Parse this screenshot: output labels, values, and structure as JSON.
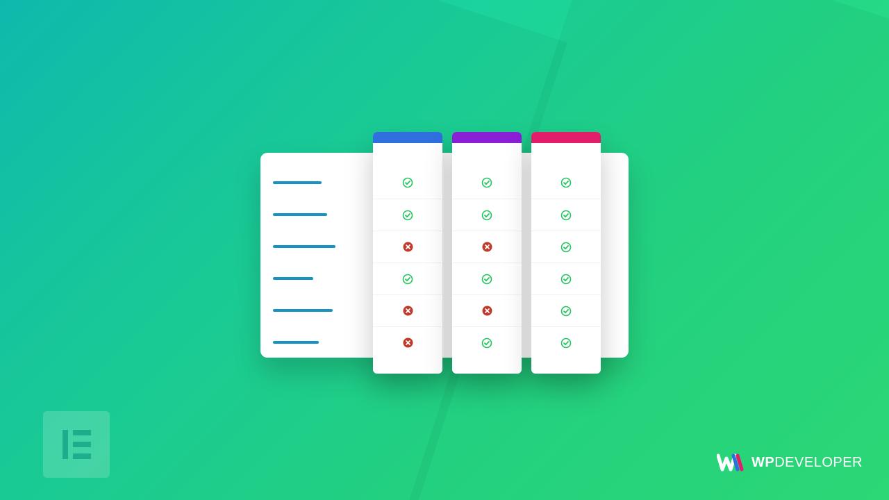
{
  "brand": {
    "name_bold": "WP",
    "name_light": "DEVELOPER"
  },
  "badge": {
    "name": "elementor"
  },
  "colors": {
    "plan_a": "#2f6fe0",
    "plan_b": "#8a20d6",
    "plan_c": "#e21e6b",
    "check": "#22c55e",
    "cross": "#c0392b",
    "label_line": "#1693c4"
  },
  "comparison": {
    "features": [
      {
        "line_width": 70
      },
      {
        "line_width": 78
      },
      {
        "line_width": 90
      },
      {
        "line_width": 58
      },
      {
        "line_width": 86
      },
      {
        "line_width": 66
      }
    ],
    "plans": [
      {
        "cap_class": "cap-blue",
        "cells": [
          "check",
          "check",
          "cross",
          "check",
          "cross",
          "cross"
        ]
      },
      {
        "cap_class": "cap-purple",
        "cells": [
          "check",
          "check",
          "cross",
          "check",
          "cross",
          "check"
        ]
      },
      {
        "cap_class": "cap-pink",
        "cells": [
          "check",
          "check",
          "check",
          "check",
          "check",
          "check"
        ]
      }
    ]
  }
}
